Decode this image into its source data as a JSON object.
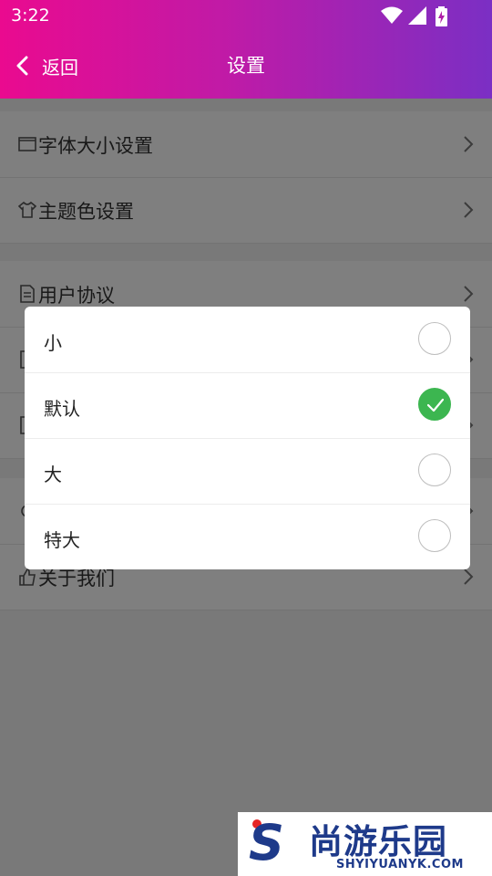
{
  "status_bar": {
    "time": "3:22"
  },
  "header": {
    "back_label": "返回",
    "title": "设置"
  },
  "settings": {
    "group1": [
      {
        "label": "字体大小设置",
        "icon": "font-size-icon"
      },
      {
        "label": "主题色设置",
        "icon": "tshirt-icon"
      }
    ],
    "group2": [
      {
        "label": "用户协议",
        "icon": "document-icon"
      },
      {
        "label": "",
        "icon": "document-icon"
      },
      {
        "label": "",
        "icon": "document-icon"
      }
    ],
    "group3": [
      {
        "label": "",
        "icon": "refresh-icon"
      },
      {
        "label": "关于我们",
        "icon": "thumbs-up-icon"
      }
    ]
  },
  "dialog": {
    "options": [
      {
        "label": "小",
        "selected": false
      },
      {
        "label": "默认",
        "selected": true
      },
      {
        "label": "大",
        "selected": false
      },
      {
        "label": "特大",
        "selected": false
      }
    ],
    "check_color": "#3cb650"
  },
  "watermark": {
    "brand": "尚游乐园",
    "url": "SHYIYUANYK.COM"
  },
  "colors": {
    "header_start": "#ea0a8f",
    "header_end": "#7b2fc4"
  }
}
